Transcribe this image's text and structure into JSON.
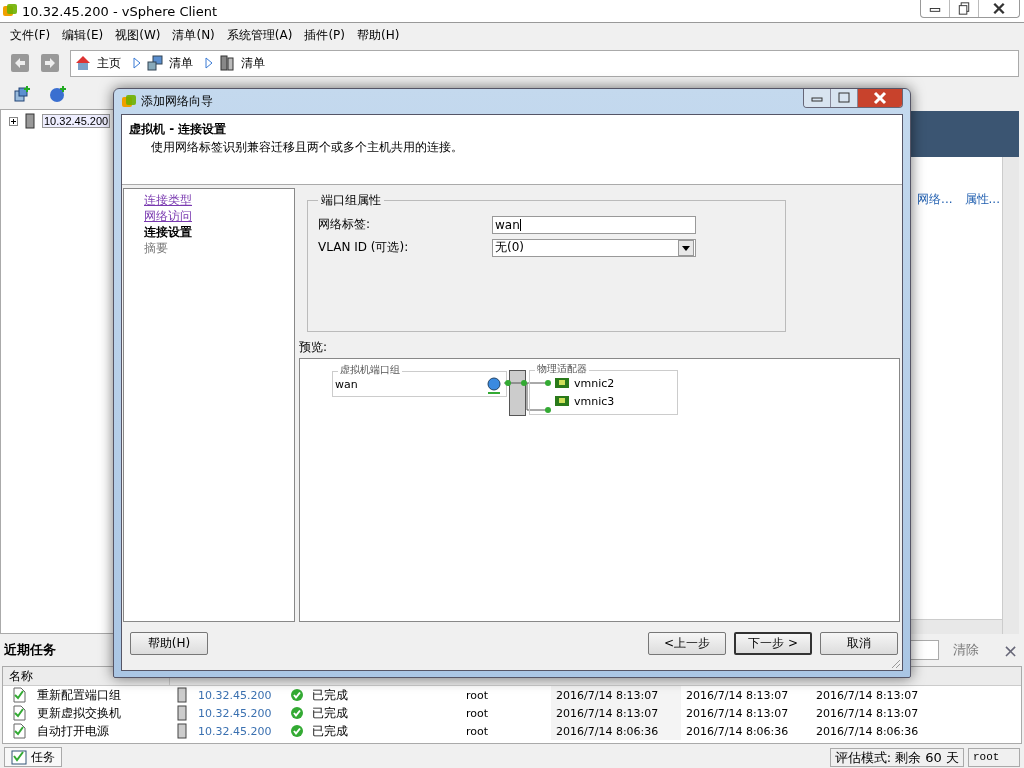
{
  "window": {
    "title": "10.32.45.200 - vSphere Client"
  },
  "menu": [
    "文件(F)",
    "编辑(E)",
    "视图(W)",
    "清单(N)",
    "系统管理(A)",
    "插件(P)",
    "帮助(H)"
  ],
  "breadcrumb": [
    {
      "label": "主页",
      "kind": "home"
    },
    {
      "label": "清单",
      "kind": "inventory"
    },
    {
      "label": "清单",
      "kind": "host"
    }
  ],
  "tree": [
    {
      "label": "10.32.45.200",
      "expanded": false,
      "selected": true
    }
  ],
  "right_panel": {
    "links": [
      "网络...",
      "属性..."
    ]
  },
  "dialog": {
    "title": "添加网络向导",
    "heading": "虚拟机 - 连接设置",
    "description": "使用网络标签识别兼容迁移且两个或多个主机共用的连接。",
    "steps": [
      {
        "label": "连接类型",
        "visited": true,
        "selected": false
      },
      {
        "label": "网络访问",
        "visited": true,
        "selected": false
      },
      {
        "label": "连接设置",
        "visited": false,
        "selected": true
      },
      {
        "label": "摘要",
        "visited": false,
        "selected": false
      }
    ],
    "group": {
      "title": "端口组属性",
      "fields": [
        {
          "label": "网络标签:",
          "value": "wan",
          "kind": "text"
        },
        {
          "label": "VLAN ID (可选):",
          "value": "无(0)",
          "kind": "dropdown"
        }
      ]
    },
    "preview": {
      "label": "预览:",
      "port_group_title": "虚拟机端口组",
      "port_group_name": "wan",
      "adapters_title": "物理适配器",
      "adapters": [
        "vmnic2",
        "vmnic3"
      ]
    },
    "help": "帮助(H)",
    "buttons": [
      {
        "label": "<上一步",
        "default": false
      },
      {
        "label": "下一步 >",
        "default": true
      },
      {
        "label": "取消",
        "default": false
      }
    ]
  },
  "recent_tasks": {
    "title": "近期任务",
    "clear": "清除",
    "close": "×",
    "columns": [
      "名称"
    ],
    "rows": [
      {
        "name": "重新配置端口组",
        "target": "10.32.45.200",
        "status": "已完成",
        "initiator": "root",
        "queued": "2016/7/14 8:13:07",
        "start": "2016/7/14 8:13:07",
        "end": "2016/7/14 8:13:07"
      },
      {
        "name": "更新虚拟交换机",
        "target": "10.32.45.200",
        "status": "已完成",
        "initiator": "root",
        "queued": "2016/7/14 8:13:07",
        "start": "2016/7/14 8:13:07",
        "end": "2016/7/14 8:13:07"
      },
      {
        "name": "自动打开电源",
        "target": "10.32.45.200",
        "status": "已完成",
        "initiator": "root",
        "queued": "2016/7/14 8:06:36",
        "start": "2016/7/14 8:06:36",
        "end": "2016/7/14 8:06:36"
      }
    ]
  },
  "status_bar": {
    "tasks_tab": "任务",
    "eval": "评估模式: 剩余 60 天",
    "user": "root"
  }
}
